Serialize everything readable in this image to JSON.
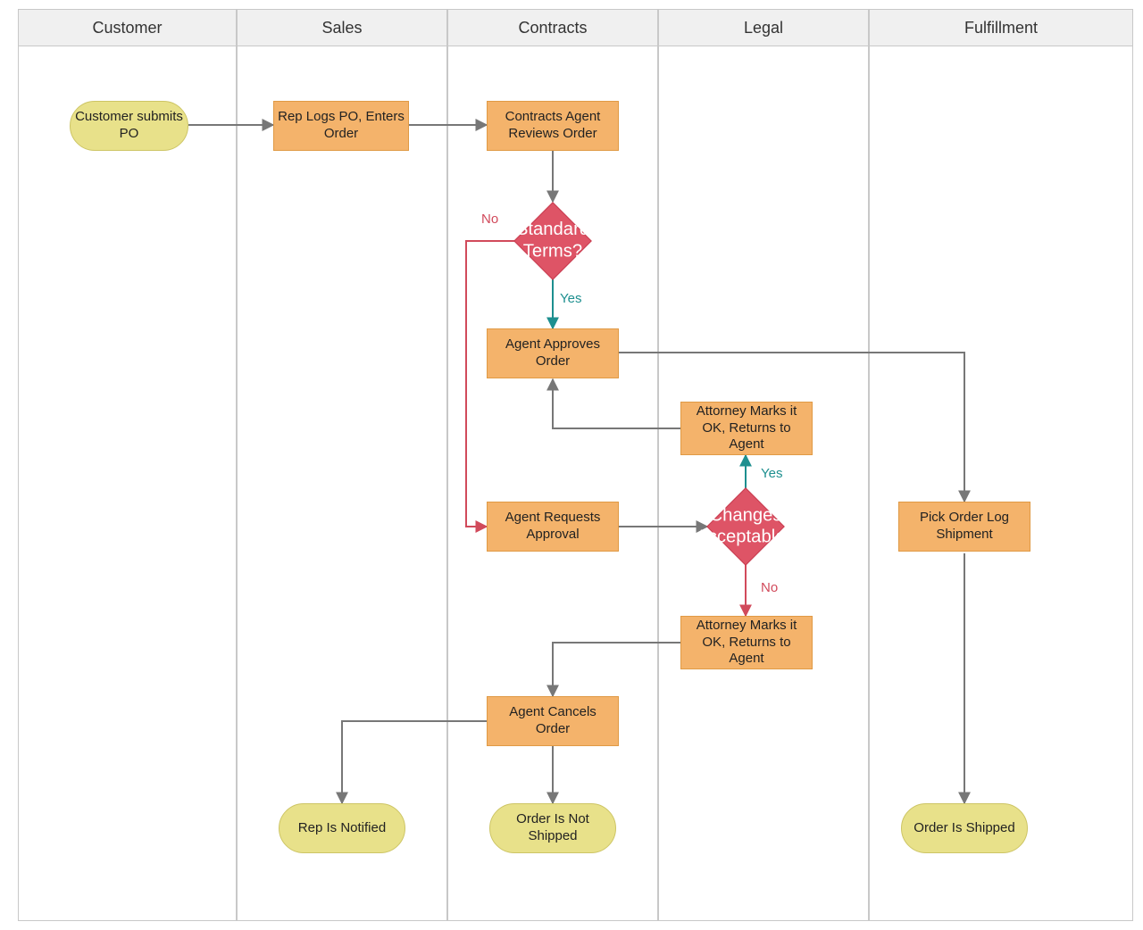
{
  "lanes": {
    "customer": {
      "title": "Customer"
    },
    "sales": {
      "title": "Sales"
    },
    "contracts": {
      "title": "Contracts"
    },
    "legal": {
      "title": "Legal"
    },
    "fulfillment": {
      "title": "Fulfillment"
    }
  },
  "nodes": {
    "customer_submits_po": "Customer submits PO",
    "rep_logs_po": "Rep Logs PO, Enters Order",
    "agent_reviews_order": "Contracts Agent Reviews Order",
    "standard_terms": "Standard Terms?",
    "agent_approves_order": "Agent Approves Order",
    "agent_requests_approval": "Agent Requests Approval",
    "changes_acceptable": "Changes Acceptable?",
    "attorney_ok_returns": "Attorney Marks it OK, Returns to Agent",
    "attorney_ok_returns2": "Attorney Marks it OK, Returns to Agent",
    "pick_order_log": "Pick Order Log Shipment",
    "agent_cancels_order": "Agent Cancels Order",
    "rep_notified": "Rep Is Notified",
    "order_not_shipped": "Order Is Not Shipped",
    "order_shipped": "Order Is Shipped"
  },
  "edge_labels": {
    "yes": "Yes",
    "no": "No"
  },
  "colors": {
    "process_fill": "#f4b36b",
    "terminator_fill": "#e8e18a",
    "decision_fill": "#de5466",
    "lane_header_fill": "#f0f0f0",
    "yes_color": "#1d8f8f",
    "no_color": "#d14a5b",
    "arrow_gray": "#777777"
  }
}
